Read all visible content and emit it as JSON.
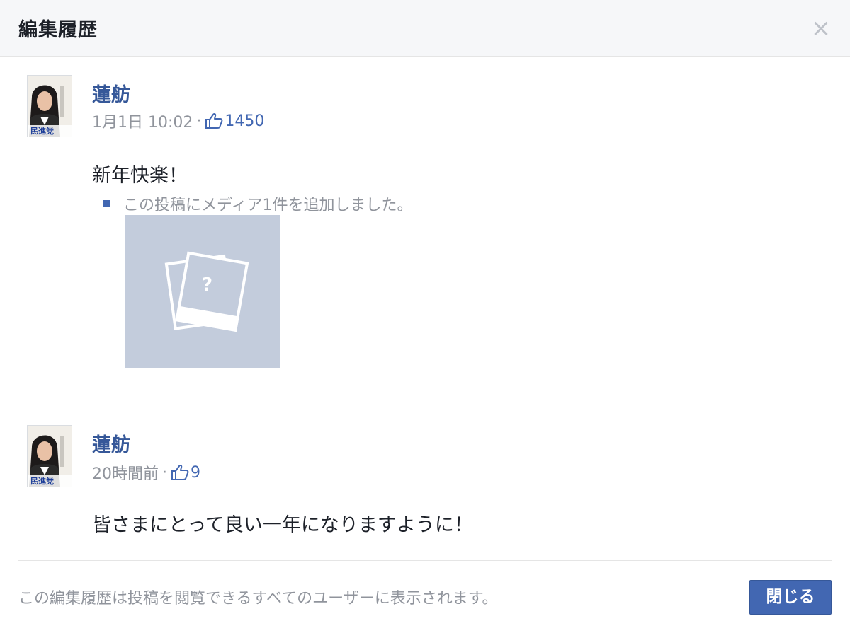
{
  "dialog": {
    "title": "編集履歴",
    "close_icon": "×"
  },
  "entries": [
    {
      "author": "蓮舫",
      "timestamp": "1月1日 10:02",
      "separator": "·",
      "like_count": "1450",
      "text": "新年快楽！",
      "change_note": "この投稿にメディア1件を追加しました。",
      "media_placeholder_glyph": "?"
    },
    {
      "author": "蓮舫",
      "timestamp": "20時間前",
      "separator": "·",
      "like_count": "9",
      "text": "皆さまにとって良い一年になりますように！"
    }
  ],
  "footer": {
    "notice": "この編集履歴は投稿を閲覧できるすべてのユーザーに表示されます。",
    "close_label": "閉じる"
  },
  "colors": {
    "link_blue": "#365899",
    "button_blue": "#4267b2",
    "meta_gray": "#90949c",
    "media_placeholder": "#c3ccdc"
  }
}
